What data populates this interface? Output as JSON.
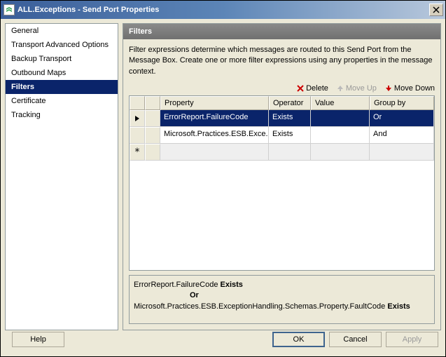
{
  "window": {
    "title": "ALL.Exceptions - Send Port Properties"
  },
  "sidebar": {
    "items": [
      {
        "label": "General"
      },
      {
        "label": "Transport Advanced Options"
      },
      {
        "label": "Backup Transport"
      },
      {
        "label": "Outbound Maps"
      },
      {
        "label": "Filters"
      },
      {
        "label": "Certificate"
      },
      {
        "label": "Tracking"
      }
    ],
    "selected_index": 4
  },
  "panel": {
    "title": "Filters",
    "description": "Filter expressions determine which messages are routed to this Send Port from the Message Box. Create one or more filter expressions using any properties in the message context."
  },
  "toolbar": {
    "delete": "Delete",
    "moveup": "Move Up",
    "movedown": "Move Down"
  },
  "grid": {
    "columns": {
      "property": "Property",
      "operator": "Operator",
      "value": "Value",
      "groupby": "Group by"
    },
    "rows": [
      {
        "property": "ErrorReport.FailureCode",
        "operator": "Exists",
        "value": "",
        "groupby": "Or"
      },
      {
        "property": "Microsoft.Practices.ESB.Exce...",
        "operator": "Exists",
        "value": "",
        "groupby": "And"
      }
    ]
  },
  "summary": {
    "l1a": "ErrorReport.FailureCode ",
    "l1b": "Exists",
    "l2": "Or",
    "l3a": "Microsoft.Practices.ESB.ExceptionHandling.Schemas.Property.FaultCode ",
    "l3b": "Exists"
  },
  "buttons": {
    "help": "Help",
    "ok": "OK",
    "cancel": "Cancel",
    "apply": "Apply"
  }
}
